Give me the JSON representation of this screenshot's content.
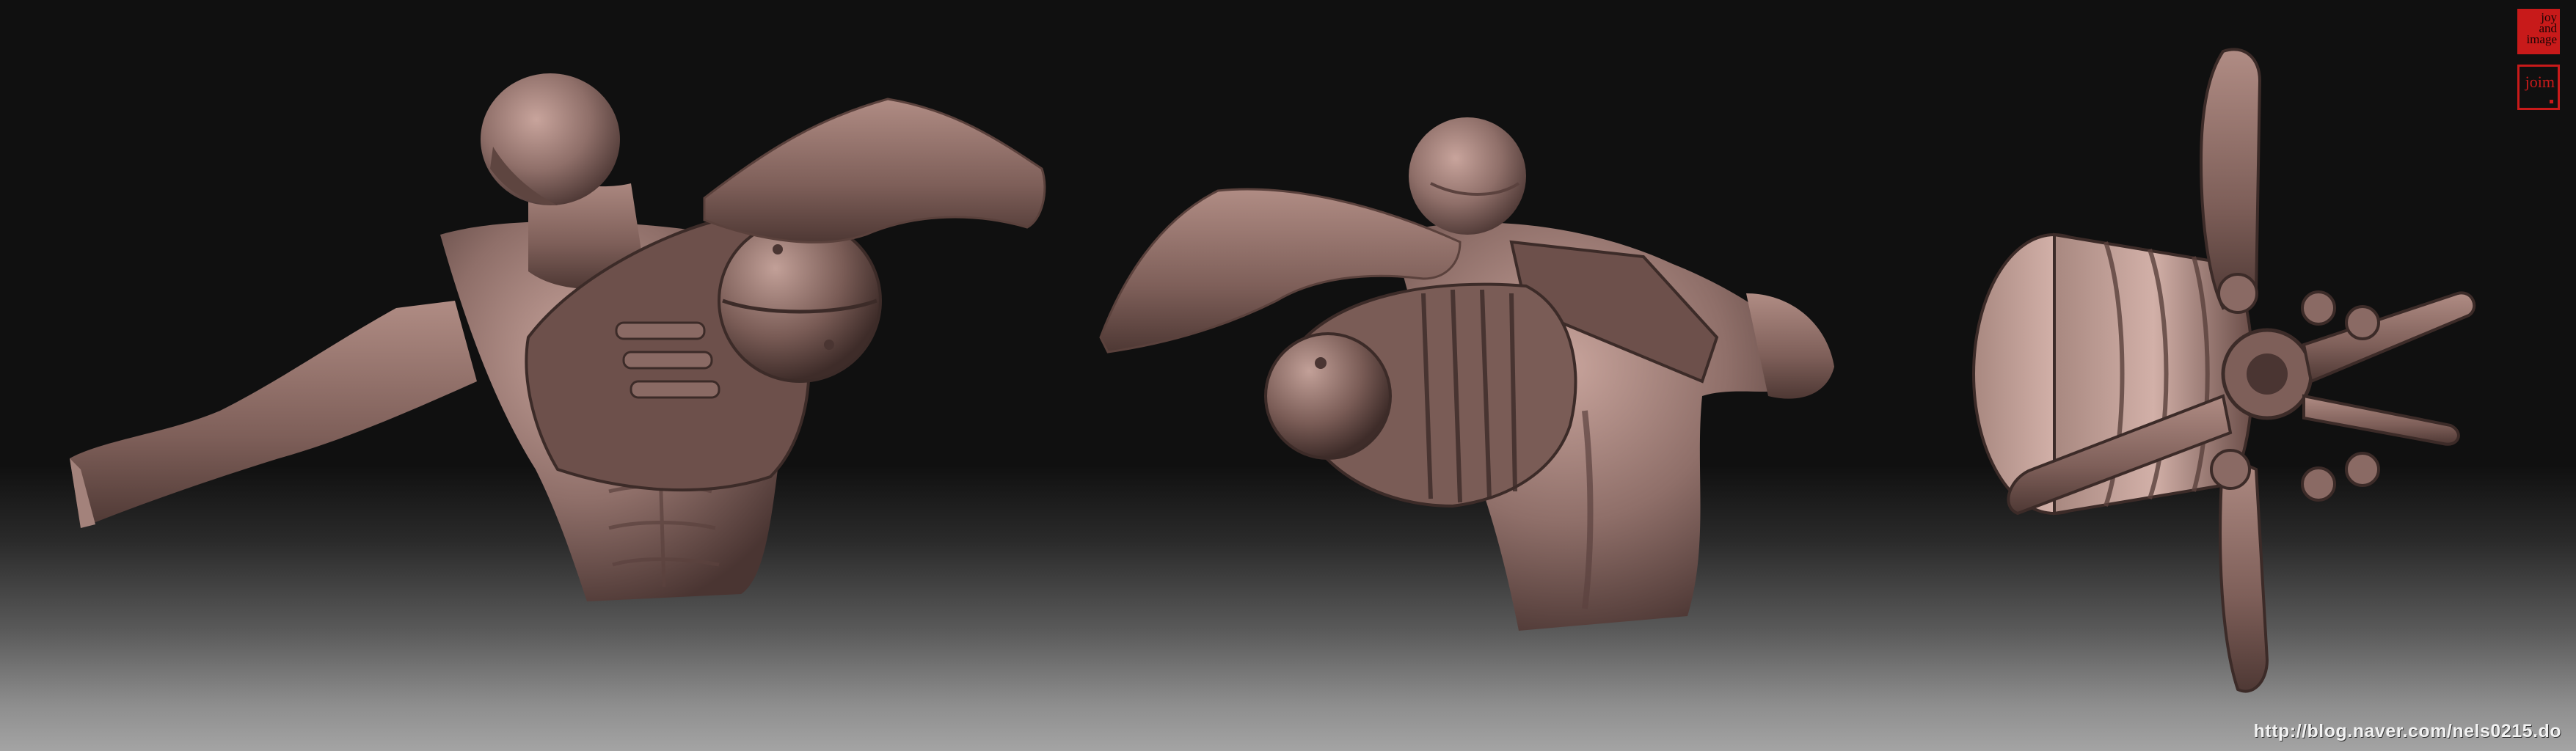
{
  "image": {
    "background_top": "#101010",
    "background_bottom": "#a4a4a4",
    "clay_color": "#8f6f69",
    "clay_highlight": "#c8a49c",
    "clay_shadow": "#4a3532"
  },
  "logo": {
    "line1": "joy",
    "line2": "and",
    "line3": "image",
    "mark_text": "joim",
    "accent": "#c81a1a"
  },
  "watermark": {
    "url": "http://blog.naver.com/nels0215.do"
  }
}
